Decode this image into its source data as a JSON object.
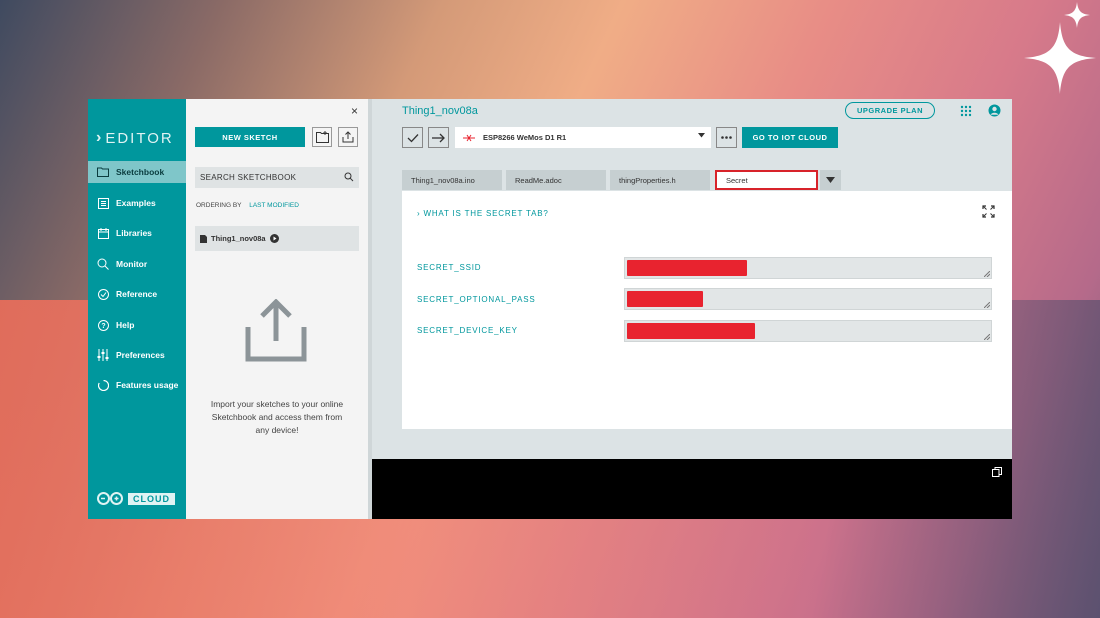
{
  "sidebar": {
    "brand": "EDITOR",
    "items": [
      {
        "label": "Sketchbook",
        "icon": "folder-icon",
        "active": true
      },
      {
        "label": "Examples",
        "icon": "examples-icon"
      },
      {
        "label": "Libraries",
        "icon": "libraries-icon"
      },
      {
        "label": "Monitor",
        "icon": "monitor-icon"
      },
      {
        "label": "Reference",
        "icon": "reference-icon"
      },
      {
        "label": "Help",
        "icon": "help-icon"
      },
      {
        "label": "Preferences",
        "icon": "preferences-icon"
      },
      {
        "label": "Features usage",
        "icon": "features-icon"
      }
    ],
    "cloud_label": "CLOUD"
  },
  "panel": {
    "close": "×",
    "new_sketch": "NEW SKETCH",
    "search_placeholder": "SEARCH SKETCHBOOK",
    "ordering_label": "ORDERING BY",
    "ordering_value": "LAST MODIFIED",
    "sketch_name": "Thing1_nov08a",
    "import_text": "Import your sketches to your online Sketchbook and access them from any device!"
  },
  "main": {
    "title": "Thing1_nov08a",
    "upgrade": "UPGRADE PLAN",
    "board": "ESP8266 WeMos D1 R1",
    "iot_button": "GO TO IOT CLOUD",
    "tabs": [
      {
        "label": "Thing1_nov08a.ino"
      },
      {
        "label": "ReadMe.adoc"
      },
      {
        "label": "thingProperties.h"
      },
      {
        "label": "Secret"
      }
    ],
    "secret_link": "WHAT IS THE SECRET TAB?",
    "fields": [
      {
        "label": "SECRET_SSID"
      },
      {
        "label": "SECRET_OPTIONAL_PASS"
      },
      {
        "label": "SECRET_DEVICE_KEY"
      }
    ]
  },
  "colors": {
    "accent": "#00979d",
    "highlight": "#d8232a",
    "redaction": "#e8232f"
  }
}
